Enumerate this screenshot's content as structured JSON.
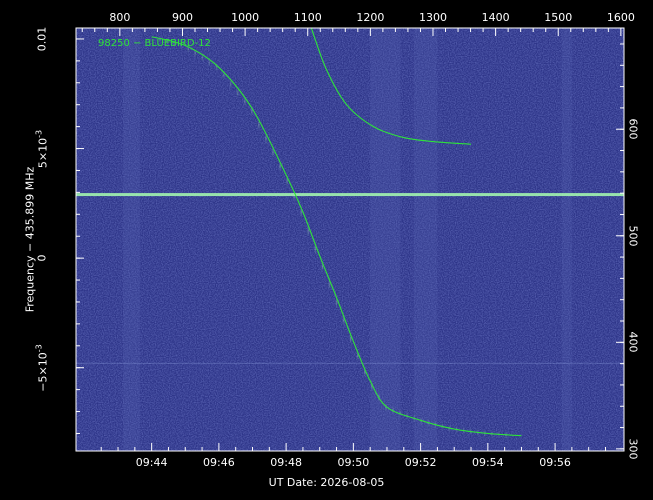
{
  "chart_data": {
    "type": "line",
    "title": "",
    "background": "spectrogram",
    "xlabel": "UT Date: 2026-08-05",
    "ylabel": "Frequency − 435.899 MHz",
    "x_bottom_ticks": [
      "09:44",
      "09:46",
      "09:48",
      "09:50",
      "09:52",
      "09:54",
      "09:56"
    ],
    "x_bottom_range_minutes": [
      -2.25,
      14.05
    ],
    "x_top_ticks": [
      "800",
      "900",
      "1000",
      "1100",
      "1200",
      "1300",
      "1400",
      "1500",
      "1600"
    ],
    "x_top_range": [
      730,
      1605
    ],
    "y_left_ticks": [
      {
        "label": "0.01",
        "value": 0.01
      },
      {
        "label": "5×10",
        "exp": "-3",
        "value": 0.005
      },
      {
        "label": "0",
        "value": 0
      },
      {
        "label": "−5×10",
        "exp": "-3",
        "value": -0.005
      }
    ],
    "y_left_range": [
      -0.0088,
      0.0105
    ],
    "y_right_ticks": [
      "300",
      "400",
      "500",
      "600"
    ],
    "y_right_range": [
      298,
      695
    ],
    "grid": false,
    "colors": {
      "background": "#2d3488",
      "line": "#2ee33a",
      "band": "#a8ffb0",
      "axes": "#ffffff"
    },
    "series": [
      {
        "name": "98250 − BLUEBIRD-12",
        "x_minutes": [
          0,
          1,
          2,
          3,
          4,
          4.5,
          5,
          5.5,
          6,
          6.5,
          7,
          8,
          9,
          10,
          11
        ],
        "y": [
          0.0101,
          0.0097,
          0.0087,
          0.0068,
          0.0038,
          0.0021,
          0.0001,
          -0.0018,
          -0.0038,
          -0.0056,
          -0.0068,
          -0.0074,
          -0.0078,
          -0.008,
          -0.0081
        ]
      },
      {
        "name": "",
        "x_minutes": [
          4.75,
          5.2,
          5.8,
          6.6,
          7.5,
          8.5,
          9.5
        ],
        "y": [
          0.0105,
          0.0086,
          0.007,
          0.006,
          0.0055,
          0.0053,
          0.0052
        ]
      }
    ],
    "horizontal_band_y": 0.0029,
    "faint_band_y": -0.0048
  }
}
